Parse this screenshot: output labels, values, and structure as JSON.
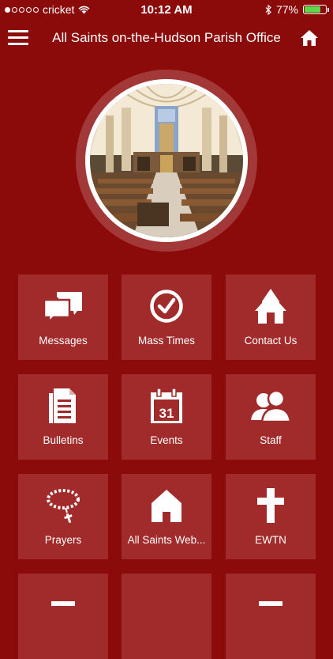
{
  "status_bar": {
    "carrier": "cricket",
    "time": "10:12 AM",
    "battery": "77%",
    "battery_level": 0.77,
    "battery_color": "#5cd64a"
  },
  "nav": {
    "title": "All Saints on-the-Hudson Parish Office"
  },
  "theme": {
    "background": "#8b0a0a",
    "tile": "#a12a2a"
  },
  "tiles": [
    {
      "label": "Messages",
      "icon": "chat-bubbles-icon"
    },
    {
      "label": "Mass Times",
      "icon": "clock-icon"
    },
    {
      "label": "Contact Us",
      "icon": "church-icon"
    },
    {
      "label": "Bulletins",
      "icon": "document-icon"
    },
    {
      "label": "Events",
      "icon": "calendar-icon",
      "icon_text": "31"
    },
    {
      "label": "Staff",
      "icon": "people-icon"
    },
    {
      "label": "Prayers",
      "icon": "rosary-icon"
    },
    {
      "label": "All Saints Web...",
      "icon": "house-icon"
    },
    {
      "label": "EWTN",
      "icon": "cross-icon"
    }
  ]
}
